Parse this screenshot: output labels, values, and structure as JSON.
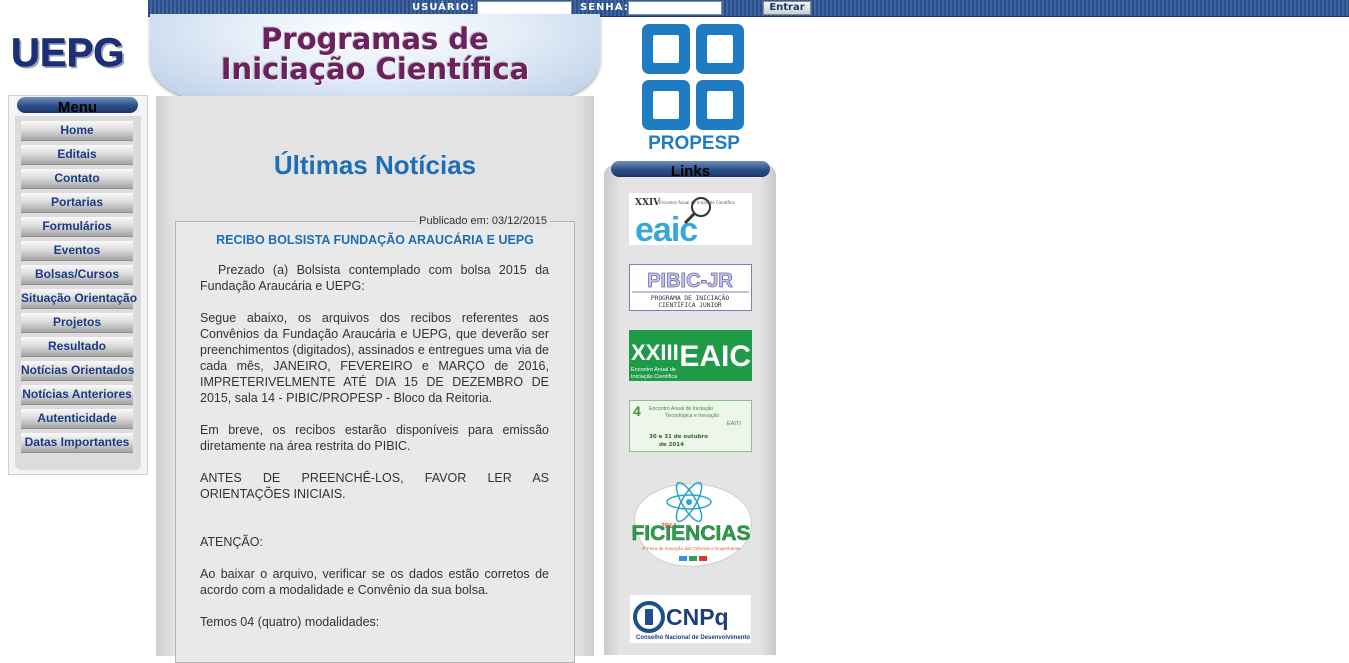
{
  "login": {
    "user_label": "USUÁRIO:",
    "user_value": "",
    "pass_label": "SENHA:",
    "pass_value": "",
    "submit_label": "Entrar"
  },
  "logo": {
    "text": "UEPG"
  },
  "banner": {
    "line1": "Programas de",
    "line2": "Iniciação Científica"
  },
  "menu": {
    "title": "Menu",
    "items": [
      {
        "label": "Home"
      },
      {
        "label": "Editais"
      },
      {
        "label": "Contato"
      },
      {
        "label": "Portarias"
      },
      {
        "label": "Formulários"
      },
      {
        "label": "Eventos"
      },
      {
        "label": "Bolsas/Cursos"
      },
      {
        "label": "Situação Orientação"
      },
      {
        "label": "Projetos"
      },
      {
        "label": "Resultado"
      },
      {
        "label": "Notícias Orientados"
      },
      {
        "label": "Notícias Anteriores"
      },
      {
        "label": "Autenticidade"
      },
      {
        "label": "Datas Importantes"
      }
    ]
  },
  "news": {
    "heading": "Últimas Notícias",
    "published": "Publicado em: 03/12/2015",
    "title": "RECIBO BOLSISTA FUNDAÇÃO ARAUCÁRIA E UEPG",
    "paragraphs": [
      "Prezado (a) Bolsista contemplado com bolsa 2015 da Fundação Araucária e UEPG:",
      "Segue abaixo, os arquivos dos recibos referentes aos Convênios da Fundação Araucária e UEPG, que deverão ser preenchimentos (digitados), assinados e entregues uma via de cada mês, JANEIRO, FEVEREIRO e MARÇO de 2016, IMPRETERIVELMENTE ATÉ DIA 15 DE DEZEMBRO DE 2015, sala 14 - PIBIC/PROPESP - Bloco da Reitoria.",
      "Em breve, os recibos estarão disponíveis para emissão diretamente na área restrita do PIBIC.",
      "ANTES DE PREENCHÊ-LOS, FAVOR LER AS ORIENTAÇÕES INICIAIS.",
      "ATENÇÃO:",
      "Ao baixar o arquivo, verificar se os dados estão corretos de acordo com a modalidade e Convênio da sua bolsa.",
      "Temos 04 (quatro) modalidades:"
    ]
  },
  "propesp": {
    "label": "PROPESP"
  },
  "links": {
    "title": "Links",
    "banners": [
      {
        "name": "eaic-xxiv",
        "line1": "XXIV",
        "line2": "Encontro Anual de Iniciação Científica",
        "main": "eaic"
      },
      {
        "name": "pibic-jr",
        "main": "PIBIC-JR",
        "sub1": "PROGRAMA DE INICIAÇÃO",
        "sub2": "CIENTÍFICA JUNIOR"
      },
      {
        "name": "eaic-xxiii",
        "roman": "XXIII",
        "main": "EAIC",
        "sub1": "Encontro Anual de",
        "sub2": "Iniciação Científica"
      },
      {
        "name": "eaiti",
        "num": "4",
        "sub1": "Encontro Anual de Iniciação",
        "sub2": "Tecnológica e Inovação",
        "sub3": "EAITI",
        "sub4": "30 e 31 de outubro",
        "sub5": "de 2014"
      },
      {
        "name": "ficiencias",
        "year": "2014",
        "main": "FICIENCIAS",
        "sub": "3ª Feira de Inovação das Ciências e Engenharias"
      },
      {
        "name": "cnpq",
        "main": "CNPq",
        "sub": "Conselho Nacional de Desenvolvimento"
      }
    ]
  }
}
